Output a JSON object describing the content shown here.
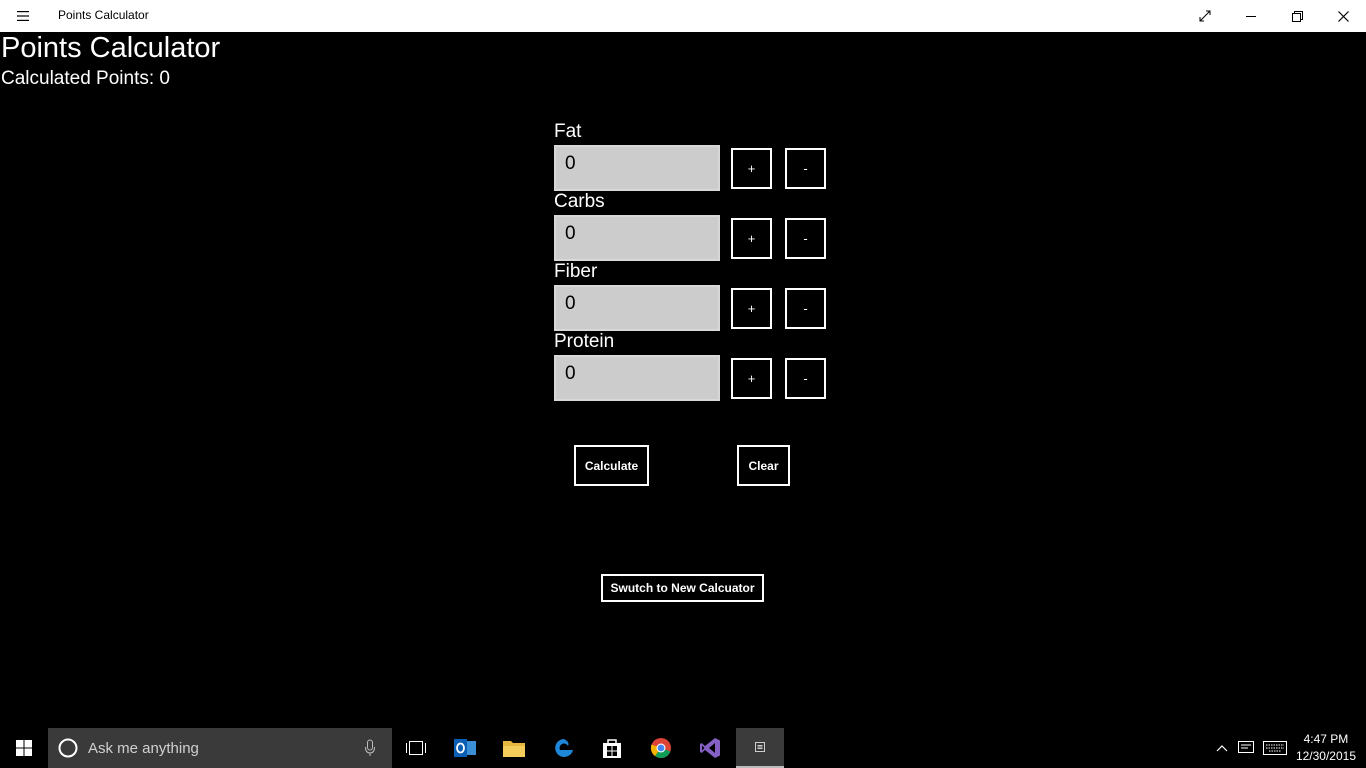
{
  "window": {
    "title": "Points Calculator",
    "icons": [
      "hamburger-menu-icon",
      "fullscreen-icon",
      "minimize-icon",
      "restore-icon",
      "close-icon"
    ]
  },
  "page": {
    "heading": "Points Calculator",
    "points_label": "Calculated Points: 0"
  },
  "fields": [
    {
      "label": "Fat",
      "value": "0",
      "plus": "+",
      "minus": "-"
    },
    {
      "label": "Carbs",
      "value": "0",
      "plus": "+",
      "minus": "-"
    },
    {
      "label": "Fiber",
      "value": "0",
      "plus": "+",
      "minus": "-"
    },
    {
      "label": "Protein",
      "value": "0",
      "plus": "+",
      "minus": "-"
    }
  ],
  "actions": {
    "calculate": "Calculate",
    "clear": "Clear",
    "switch": "Swutch to New Calcuator"
  },
  "taskbar": {
    "search_placeholder": "Ask me anything",
    "time": "4:47 PM",
    "date": "12/30/2015",
    "icons": [
      "windows-start-icon",
      "cortana-circle-icon",
      "microphone-icon",
      "task-view-icon",
      "outlook-icon",
      "file-explorer-icon",
      "edge-icon",
      "store-icon",
      "chrome-icon",
      "visual-studio-icon",
      "points-calculator-app-icon",
      "chevron-up-icon",
      "action-center-icon",
      "keyboard-icon"
    ]
  },
  "colors": {
    "background": "#000000",
    "titlebar": "#ffffff",
    "input_bg": "#cccccc",
    "button_border": "#ffffff"
  }
}
